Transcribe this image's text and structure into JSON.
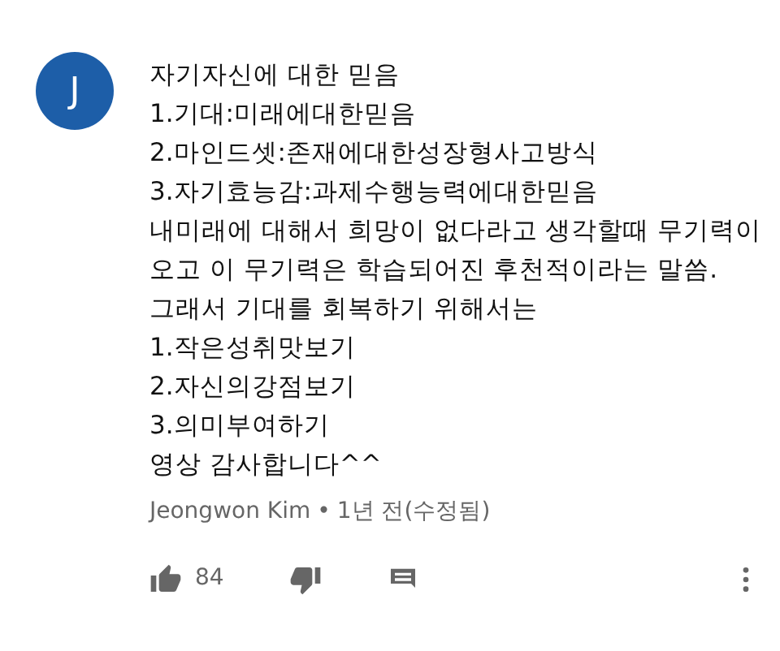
{
  "comment": {
    "avatar_letter": "J",
    "lines": [
      "자기자신에 대한 믿음",
      "1.기대:미래에대한믿음",
      "2.마인드셋:존재에대한성장형사고방식",
      "3.자기효능감:과제수행능력에대한믿음",
      "내미래에 대해서 희망이 없다라고 생각할때 무기력이",
      "오고 이 무기력은 학습되어진 후천적이라는 말씀.",
      "그래서 기대를 회복하기 위해서는",
      "1.작은성취맛보기",
      "2.자신의강점보기",
      "3.의미부여하기",
      "영상 감사합니다^^"
    ],
    "author": "Jeongwon Kim",
    "separator": "•",
    "time": "1년 전(수정됨)",
    "like_count": "84"
  }
}
